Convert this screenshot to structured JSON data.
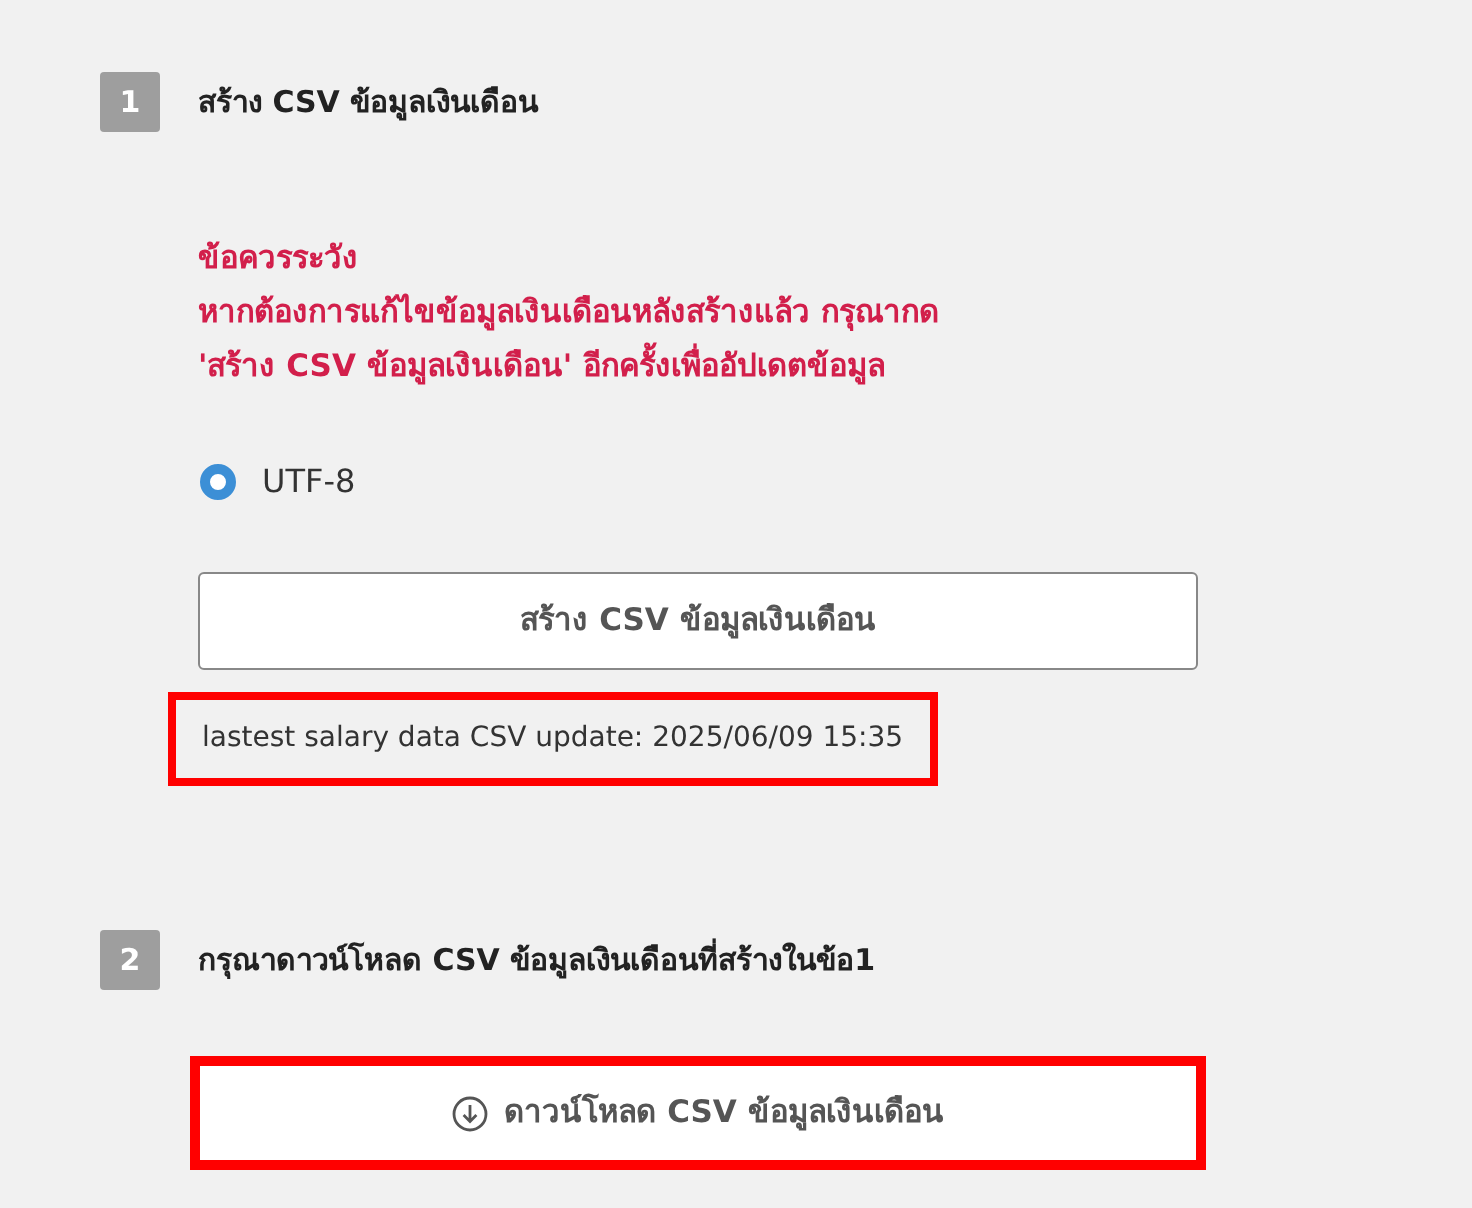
{
  "steps": [
    {
      "number": "1",
      "title": "สร้าง CSV ข้อมูลเงินเดือน",
      "warning": [
        "ข้อควรระวัง",
        "หากต้องการแก้ไขข้อมูลเงินเดือนหลังสร้างแล้ว กรุณากด",
        "'สร้าง CSV ข้อมูลเงินเดือน' อีกครั้งเพื่ออัปเดตข้อมูล"
      ],
      "encodings": [
        {
          "label": "UTF-8",
          "selected": true
        }
      ],
      "button": {
        "label": "สร้าง CSV ข้อมูลเงินเดือน",
        "kind": "create",
        "highlighted": false
      },
      "note": {
        "text": "lastest salary data CSV update: 2025/06/09 15:35",
        "highlighted": true
      }
    },
    {
      "number": "2",
      "title": "กรุณาดาวน์โหลด CSV ข้อมูลเงินเดือนที่สร้างในข้อ1",
      "button": {
        "label": "ดาวน์โหลด CSV ข้อมูลเงินเดือน",
        "kind": "download",
        "highlighted": true
      }
    }
  ]
}
